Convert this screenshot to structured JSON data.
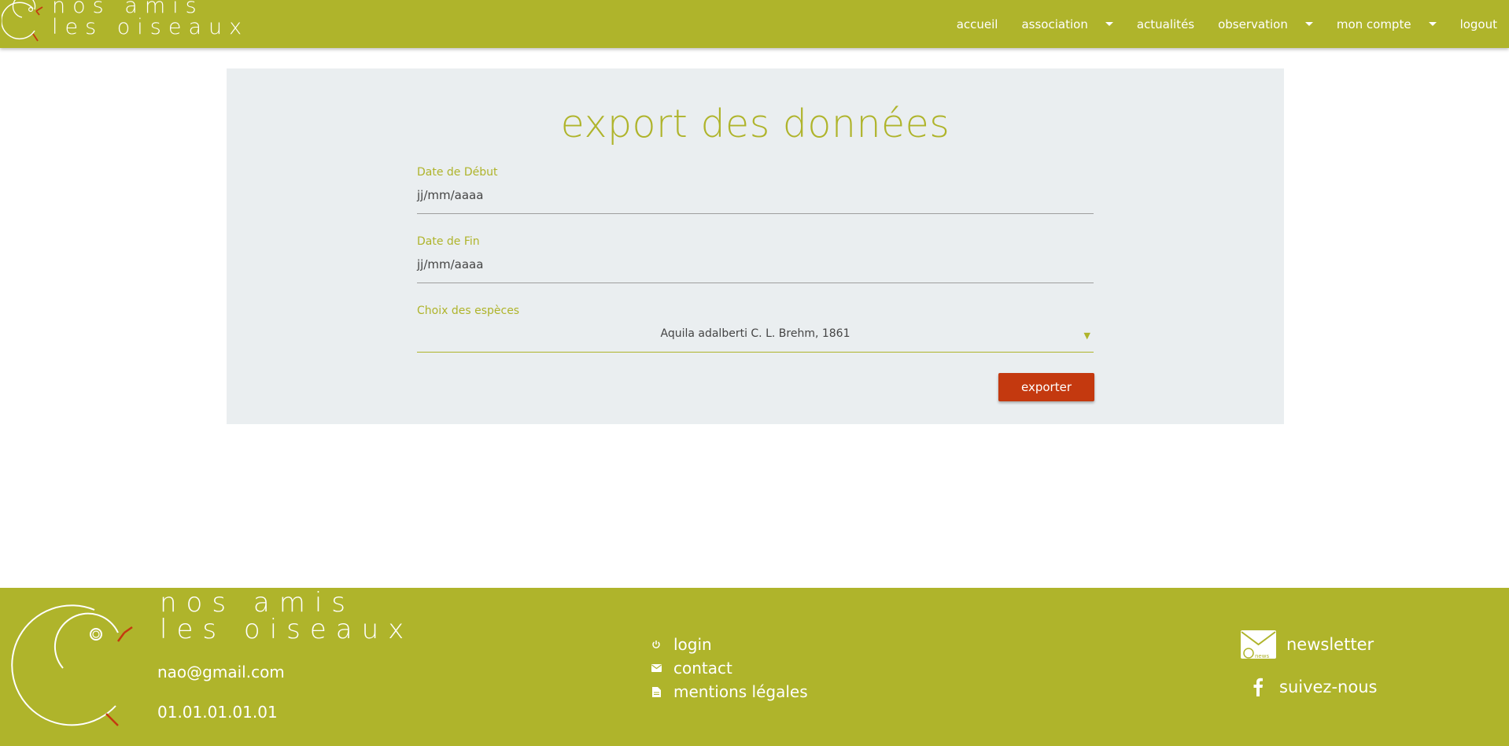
{
  "brand": {
    "line1": "nos amis",
    "line2": "les oiseaux"
  },
  "nav": {
    "items": [
      {
        "label": "accueil",
        "dropdown": false
      },
      {
        "label": "association",
        "dropdown": true
      },
      {
        "label": "actualités",
        "dropdown": false
      },
      {
        "label": "observation",
        "dropdown": true
      },
      {
        "label": "mon compte",
        "dropdown": true
      },
      {
        "label": "logout",
        "dropdown": false
      }
    ]
  },
  "page": {
    "title": "export des données",
    "start_date": {
      "label": "Date de Début",
      "value": "jj/mm/aaaa"
    },
    "end_date": {
      "label": "Date de Fin",
      "value": "jj/mm/aaaa"
    },
    "species": {
      "label": "Choix des espèces",
      "value": "Aquila adalberti C. L. Brehm, 1861",
      "caret": "▼"
    },
    "export_button": "exporter"
  },
  "footer": {
    "email": "nao@gmail.com",
    "phone": "01.01.01.01.01",
    "links": [
      {
        "label": "login",
        "icon": "power-icon"
      },
      {
        "label": "contact",
        "icon": "mail-icon"
      },
      {
        "label": "mentions légales",
        "icon": "document-icon"
      }
    ],
    "newsletter": "newsletter",
    "newsletter_icon_text": "news",
    "follow": "suivez-nous"
  },
  "colors": {
    "primary": "#afb42b",
    "accent": "#c4390f",
    "card_bg": "#eaeef0"
  }
}
